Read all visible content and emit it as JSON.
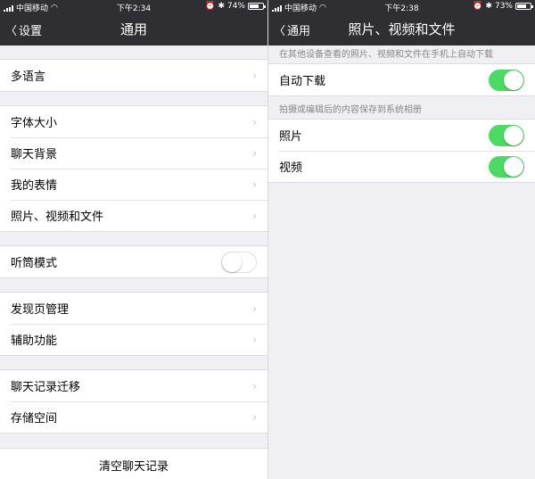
{
  "left": {
    "status": {
      "carrier": "中国移动",
      "time": "下午2:34",
      "battery": "74%",
      "battery_level": 0.74
    },
    "nav": {
      "back": "设置",
      "title": "通用"
    },
    "groups": [
      [
        "多语言"
      ],
      [
        "字体大小",
        "聊天背景",
        "我的表情",
        "照片、视频和文件"
      ],
      [
        "听筒模式"
      ],
      [
        "发现页管理",
        "辅助功能"
      ],
      [
        "聊天记录迁移",
        "存储空间"
      ]
    ],
    "earpiece_toggle": false,
    "clear_button": "清空聊天记录"
  },
  "right": {
    "status": {
      "carrier": "中国移动",
      "time": "下午2:38",
      "battery": "73%",
      "battery_level": 0.73
    },
    "nav": {
      "back": "通用",
      "title": "照片、视频和文件"
    },
    "section1_note": "在其他设备查看的照片、视频和文件在手机上自动下载",
    "auto_download": {
      "label": "自动下载",
      "on": true
    },
    "section2_note": "拍摄或编辑后的内容保存到系统相册",
    "photo": {
      "label": "照片",
      "on": true
    },
    "video": {
      "label": "视频",
      "on": true
    }
  },
  "colors": {
    "navbar": "#2e2e33",
    "toggle_on": "#4cd964",
    "background": "#efeff4"
  }
}
